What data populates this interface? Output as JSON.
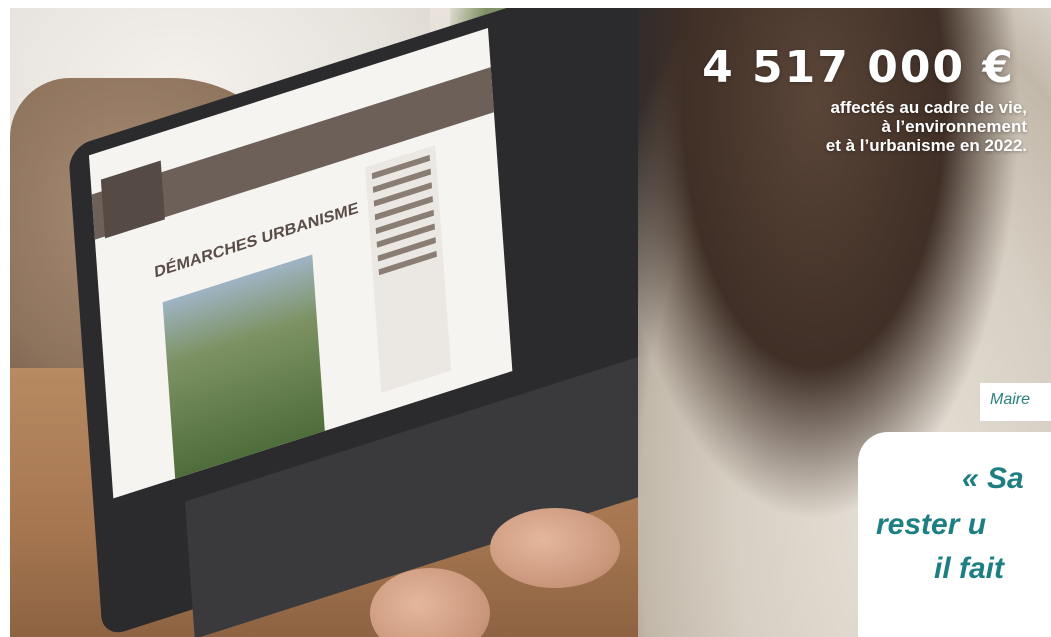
{
  "stat": {
    "amount": "4 517 000 €",
    "lines": [
      "affectés au cadre de vie,",
      "à l’environnement",
      "et à l’urbanisme en 2022."
    ]
  },
  "label": "Maire",
  "quote": {
    "lines": [
      "« Sa",
      "rester u",
      "il fait"
    ]
  },
  "screen": {
    "page_title": "DÉMARCHES URBANISME"
  },
  "colors": {
    "accent_teal": "#1e7f82",
    "text_white": "#ffffff"
  }
}
